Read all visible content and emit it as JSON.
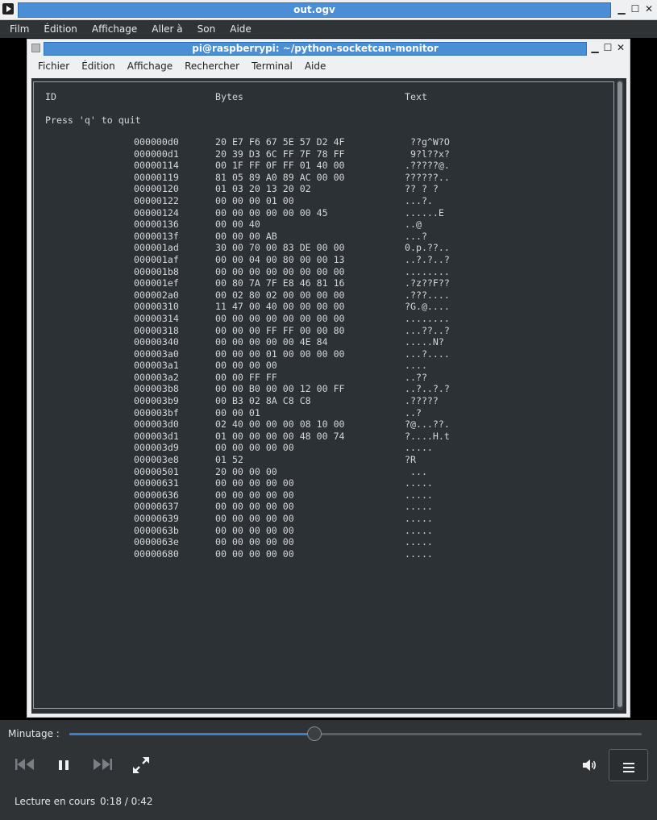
{
  "window": {
    "title": "out.ogv"
  },
  "menubar": [
    "Film",
    "Édition",
    "Affichage",
    "Aller à",
    "Son",
    "Aide"
  ],
  "terminal": {
    "title": "pi@raspberrypi: ~/python-socketcan-monitor",
    "menu": [
      "Fichier",
      "Édition",
      "Affichage",
      "Rechercher",
      "Terminal",
      "Aide"
    ],
    "headers": {
      "id": "ID",
      "bytes": "Bytes",
      "text": "Text"
    },
    "prompt": "Press 'q' to quit",
    "rows": [
      {
        "id": "000000d0",
        "bytes": "20 E7 F6 67 5E 57 D2 4F",
        "text": " ??g^W?O"
      },
      {
        "id": "000000d1",
        "bytes": "20 39 D3 6C FF 7F 78 FF",
        "text": " 9?l??x?"
      },
      {
        "id": "00000114",
        "bytes": "00 1F FF 0F FF 01 40 00",
        "text": ".?????@."
      },
      {
        "id": "00000119",
        "bytes": "81 05 89 A0 89 AC 00 00",
        "text": "??????.."
      },
      {
        "id": "00000120",
        "bytes": "01 03 20 13 20 02",
        "text": "?? ? ?"
      },
      {
        "id": "00000122",
        "bytes": "00 00 00 01 00",
        "text": "...?."
      },
      {
        "id": "00000124",
        "bytes": "00 00 00 00 00 00 45",
        "text": "......E"
      },
      {
        "id": "00000136",
        "bytes": "00 00 40",
        "text": "..@"
      },
      {
        "id": "0000013f",
        "bytes": "00 00 00 AB",
        "text": "...?"
      },
      {
        "id": "000001ad",
        "bytes": "30 00 70 00 83 DE 00 00",
        "text": "0.p.??.."
      },
      {
        "id": "000001af",
        "bytes": "00 00 04 00 80 00 00 13",
        "text": "..?.?..?"
      },
      {
        "id": "000001b8",
        "bytes": "00 00 00 00 00 00 00 00",
        "text": "........"
      },
      {
        "id": "000001ef",
        "bytes": "00 80 7A 7F E8 46 81 16",
        "text": ".?z??F??"
      },
      {
        "id": "000002a0",
        "bytes": "00 02 80 02 00 00 00 00",
        "text": ".???...."
      },
      {
        "id": "00000310",
        "bytes": "11 47 00 40 00 00 00 00",
        "text": "?G.@...."
      },
      {
        "id": "00000314",
        "bytes": "00 00 00 00 00 00 00 00",
        "text": "........"
      },
      {
        "id": "00000318",
        "bytes": "00 00 00 FF FF 00 00 80",
        "text": "...??..?"
      },
      {
        "id": "00000340",
        "bytes": "00 00 00 00 00 4E 84",
        "text": ".....N?"
      },
      {
        "id": "000003a0",
        "bytes": "00 00 00 01 00 00 00 00",
        "text": "...?...."
      },
      {
        "id": "000003a1",
        "bytes": "00 00 00 00",
        "text": "...."
      },
      {
        "id": "000003a2",
        "bytes": "00 00 FF FF",
        "text": "..??"
      },
      {
        "id": "000003b8",
        "bytes": "00 00 B0 00 00 12 00 FF",
        "text": "..?..?.?"
      },
      {
        "id": "000003b9",
        "bytes": "00 B3 02 8A C8 C8",
        "text": ".?????"
      },
      {
        "id": "000003bf",
        "bytes": "00 00 01",
        "text": "..?"
      },
      {
        "id": "000003d0",
        "bytes": "02 40 00 00 00 08 10 00",
        "text": "?@...??."
      },
      {
        "id": "000003d1",
        "bytes": "01 00 00 00 00 48 00 74",
        "text": "?....H.t"
      },
      {
        "id": "000003d9",
        "bytes": "00 00 00 00 00",
        "text": "....."
      },
      {
        "id": "000003e8",
        "bytes": "01 52",
        "text": "?R"
      },
      {
        "id": "00000501",
        "bytes": "20 00 00 00",
        "text": " ..."
      },
      {
        "id": "00000631",
        "bytes": "00 00 00 00 00",
        "text": "....."
      },
      {
        "id": "00000636",
        "bytes": "00 00 00 00 00",
        "text": "....."
      },
      {
        "id": "00000637",
        "bytes": "00 00 00 00 00",
        "text": "....."
      },
      {
        "id": "00000639",
        "bytes": "00 00 00 00 00",
        "text": "....."
      },
      {
        "id": "0000063b",
        "bytes": "00 00 00 00 00",
        "text": "....."
      },
      {
        "id": "0000063e",
        "bytes": "00 00 00 00 00",
        "text": "....."
      },
      {
        "id": "00000680",
        "bytes": "00 00 00 00 00",
        "text": "....."
      }
    ]
  },
  "player": {
    "timing_label": "Minutage :",
    "progress_fraction": 0.4286,
    "status": "Lecture en cours",
    "time": "0:18 / 0:42"
  },
  "icons": {
    "prev": "skip-back-icon",
    "pause": "pause-icon",
    "next": "skip-forward-icon",
    "fullscreen": "fullscreen-icon",
    "volume": "volume-icon",
    "menu": "hamburger-menu-icon"
  },
  "colors": {
    "accent": "#4a8fd6",
    "terminal_bg": "#2c3136",
    "text": "#d6d6d6"
  }
}
